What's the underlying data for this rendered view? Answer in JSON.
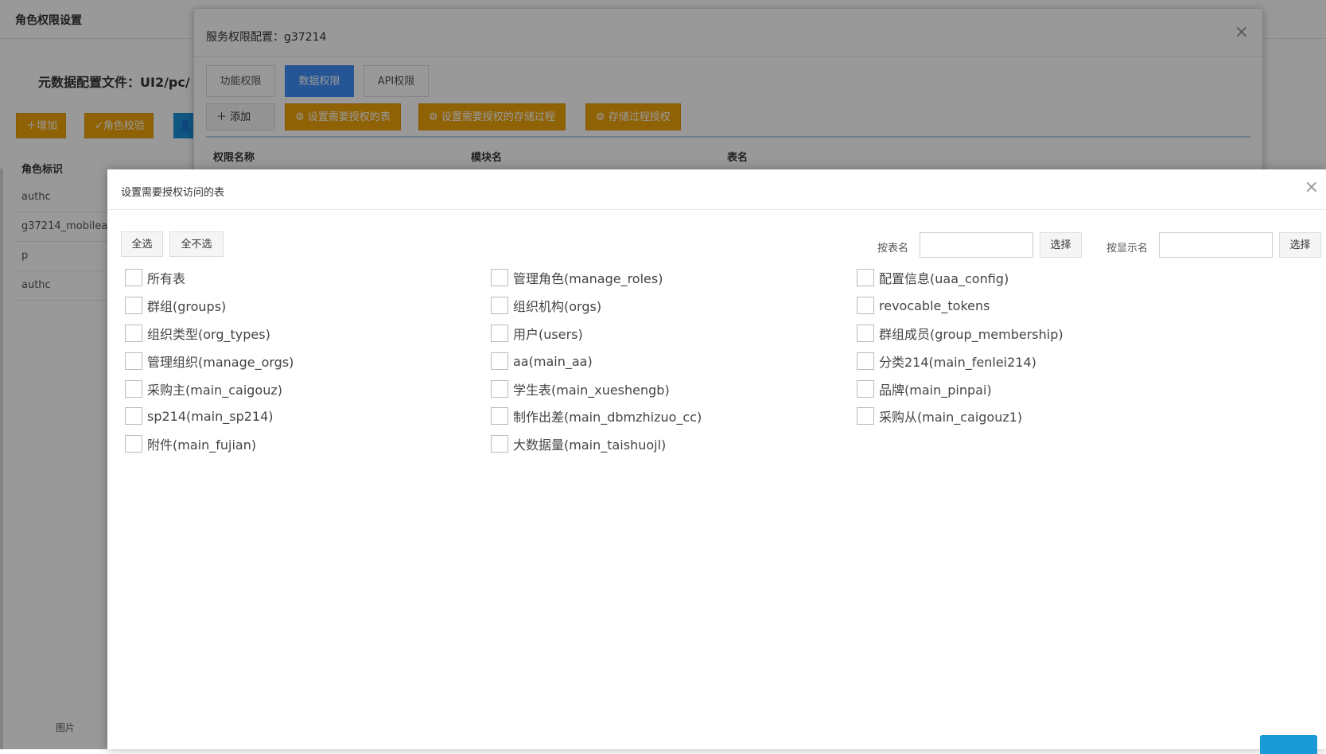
{
  "background": {
    "header_title": "角色权限设置",
    "config_label": "元数据配置文件：UI2/pc/",
    "buttons": [
      {
        "icon": "plus-icon",
        "label": "增加"
      },
      {
        "icon": "check-icon",
        "label": "角色校验"
      }
    ],
    "column_header": "角色标识",
    "rows": [
      "authc",
      "g37214_mobilea",
      "p",
      "authc"
    ],
    "footer_text": "图片"
  },
  "service_dialog": {
    "title": "服务权限配置：g37214",
    "tabs": [
      "功能权限",
      "数据权限",
      "API权限"
    ],
    "active_tab": "数据权限",
    "toolbar": {
      "add": "添加",
      "set_tables": "设置需要授权的表",
      "set_procedures": "设置需要授权的存储过程",
      "procedure_auth": "存储过程授权"
    },
    "columns": [
      "权限名称",
      "模块名",
      "表名"
    ]
  },
  "table_dialog": {
    "title": "设置需要授权访问的表",
    "select_all": "全选",
    "select_none": "全不选",
    "filter_by_name": {
      "label": "按表名",
      "value": "",
      "button": "选择"
    },
    "filter_by_display": {
      "label": "按显示名",
      "value": "",
      "button": "选择"
    },
    "tables": [
      "所有表",
      "管理角色(manage_roles)",
      "配置信息(uaa_config)",
      "群组(groups)",
      "组织机构(orgs)",
      "revocable_tokens",
      "组织类型(org_types)",
      "用户(users)",
      "群组成员(group_membership)",
      "管理组织(manage_orgs)",
      "aa(main_aa)",
      "分类214(main_fenlei214)",
      "采购主(main_caigouz)",
      "学生表(main_xueshengb)",
      "品牌(main_pinpai)",
      "sp214(main_sp214)",
      "制作出差(main_dbmzhizuo_cc)",
      "采购从(main_caigouz1)",
      "附件(main_fujian)",
      "大数据量(main_taishuojl)"
    ]
  },
  "colors": {
    "orange": "#f0a30a",
    "active_tab": "#3e8ef7",
    "confirm": "#1a9ad6"
  }
}
